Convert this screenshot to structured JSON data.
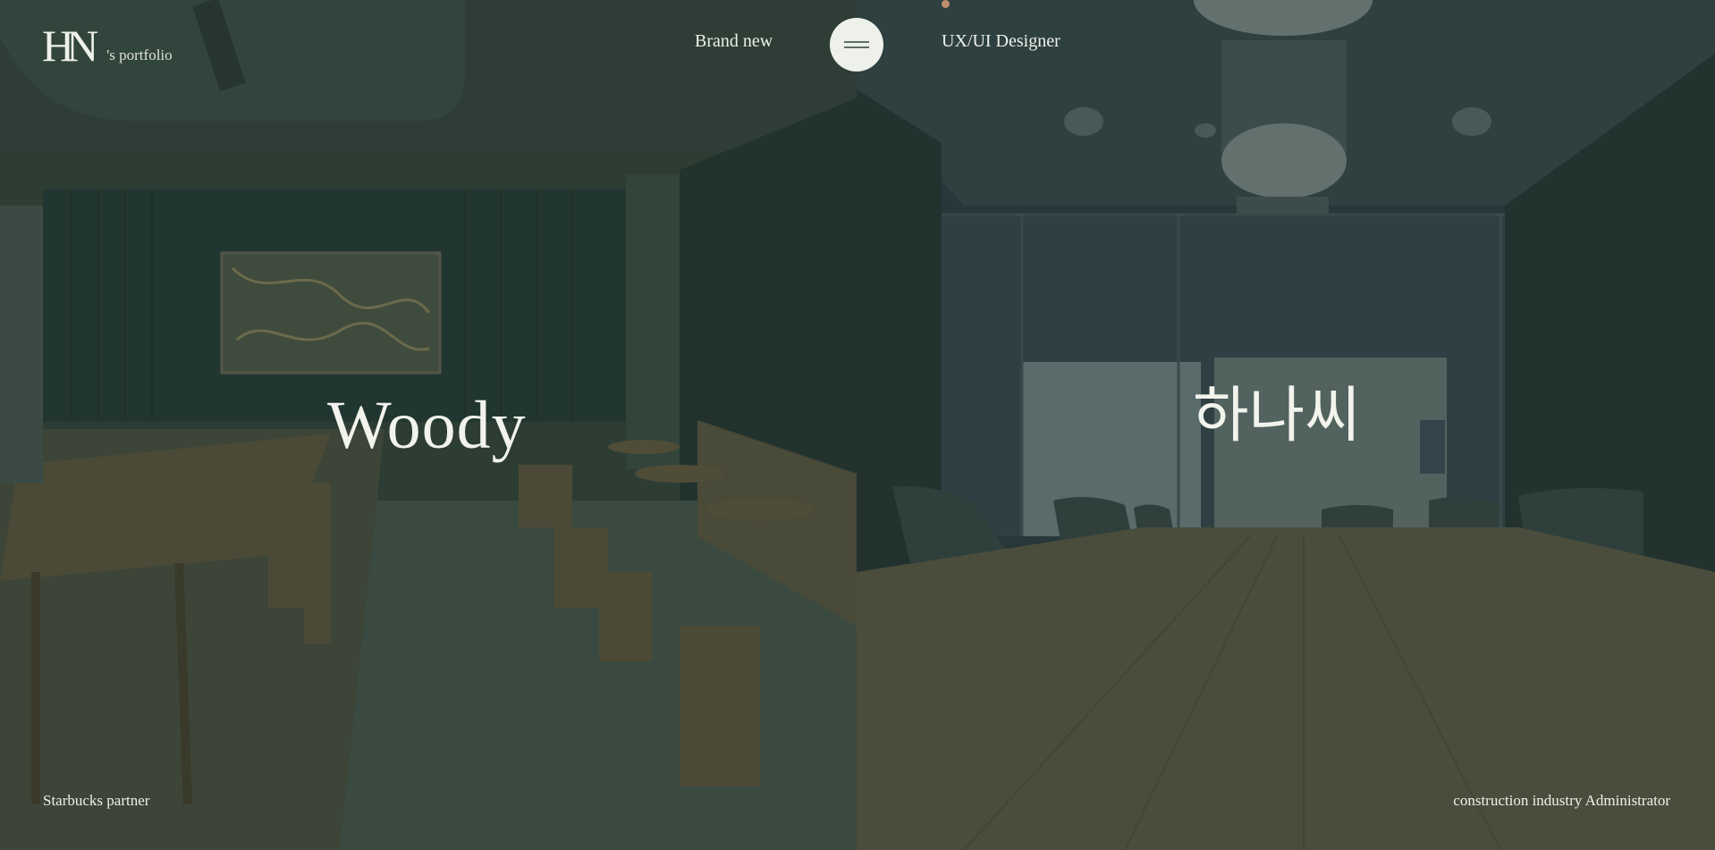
{
  "logo": {
    "mark": "HN",
    "subtitle": "'s portfolio"
  },
  "nav": {
    "left_label": "Brand new",
    "right_label": "UX/UI Designer"
  },
  "menu": {
    "icon": "hamburger-icon"
  },
  "left_panel": {
    "title": "Woody",
    "caption": "Starbucks partner",
    "scene": "cafe-interior"
  },
  "right_panel": {
    "title": "하나씨",
    "caption": "construction industry Administrator",
    "scene": "meeting-room"
  },
  "colors": {
    "overlay": "#2b3b33",
    "text": "#eef1ea",
    "accent": "#c08d6a"
  }
}
